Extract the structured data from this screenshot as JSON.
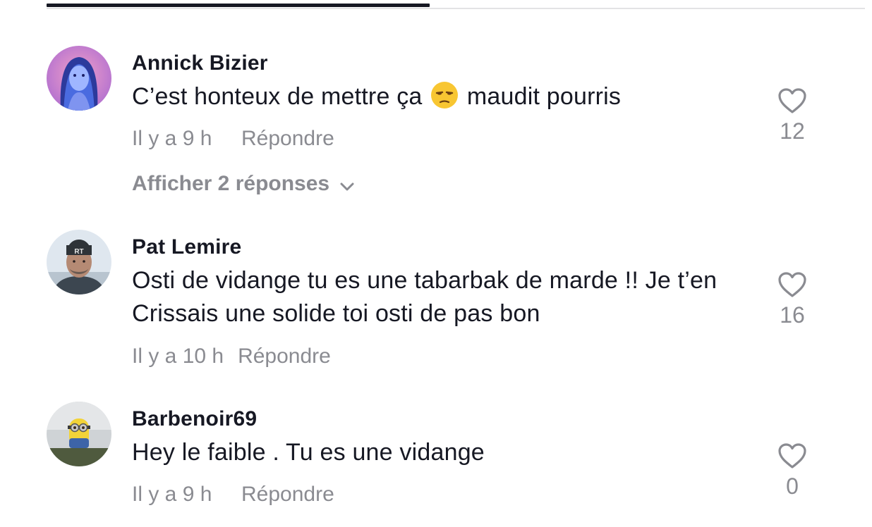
{
  "comments": [
    {
      "username": "Annick Bizier",
      "text_before": "C’est honteux de mettre ça",
      "emoji": "😒",
      "text_after": "maudit pourris",
      "time": "Il y a 9 h",
      "reply_label": "Répondre",
      "likes": "12",
      "view_replies": "Afficher 2 réponses"
    },
    {
      "username": "Pat Lemire",
      "text": "Osti de vidange tu es une tabarbak de marde !! Je t’en Crissais une solide toi osti de pas bon",
      "time": "Il y a 10 h",
      "reply_label": "Répondre",
      "likes": "16"
    },
    {
      "username": "Barbenoir69",
      "text": "Hey le faible . Tu es une vidange",
      "time": "Il y a 9 h",
      "reply_label": "Répondre",
      "likes": "0"
    }
  ],
  "icons": {
    "like": "heart-outline-icon",
    "expand": "chevron-down-icon"
  },
  "colors": {
    "text_primary": "#161823",
    "text_secondary": "#8a8b91",
    "divider": "#e3e3e5"
  }
}
